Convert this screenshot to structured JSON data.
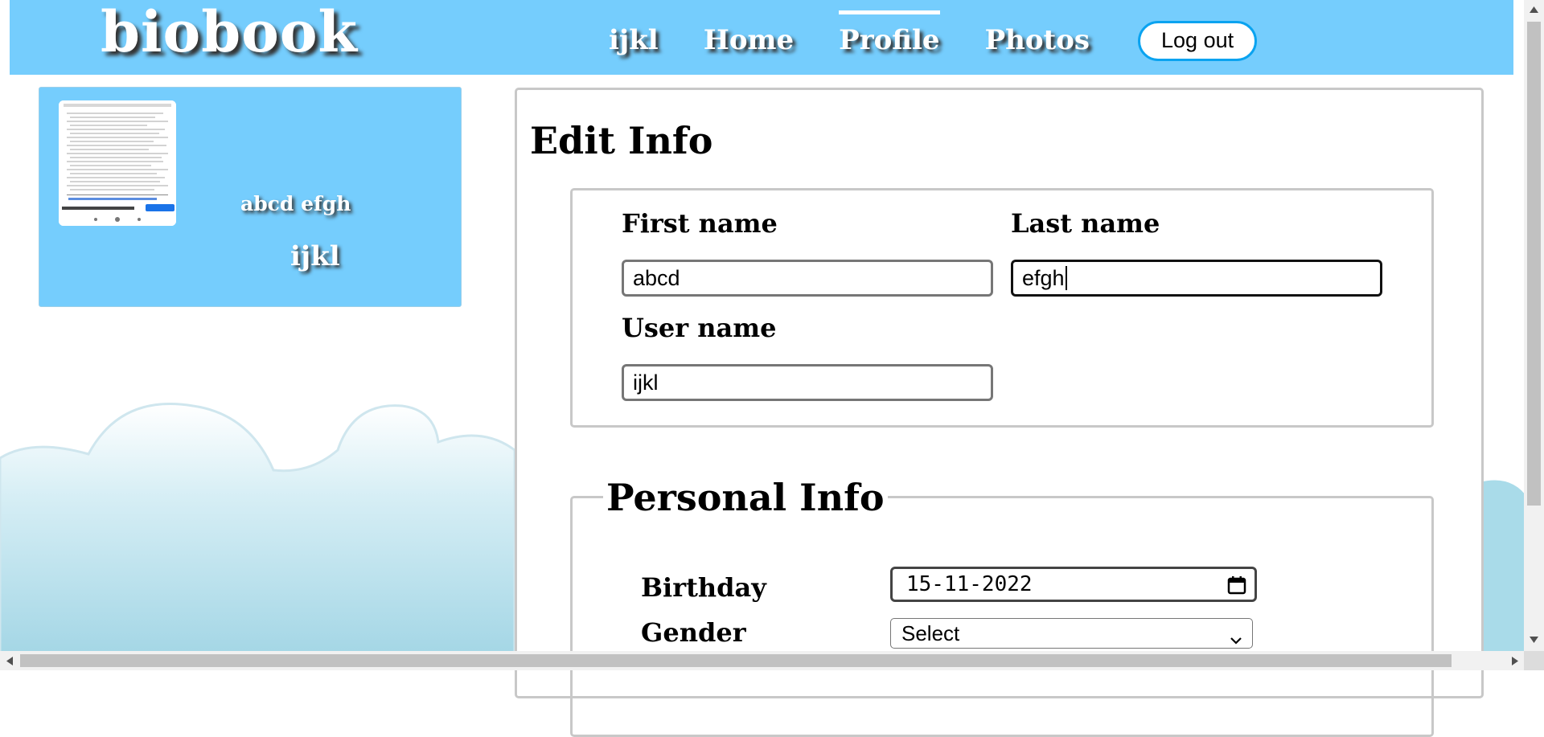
{
  "header": {
    "logo": "biobook",
    "nav": [
      {
        "label": "ijkl",
        "active": false
      },
      {
        "label": "Home",
        "active": false
      },
      {
        "label": "Profile",
        "active": true
      },
      {
        "label": "Photos",
        "active": false
      }
    ],
    "logout_label": "Log out"
  },
  "profile": {
    "full_name": "abcd efgh",
    "username": "ijkl"
  },
  "edit": {
    "title": "Edit Info",
    "first_name_label": "First name",
    "first_name_value": "abcd",
    "last_name_label": "Last name",
    "last_name_value": "efgh",
    "user_name_label": "User name",
    "user_name_value": "ijkl"
  },
  "personal": {
    "legend": "Personal Info",
    "birthday_label": "Birthday",
    "birthday_value": "15-11-2022",
    "gender_label": "Gender",
    "gender_value": "Select"
  },
  "colors": {
    "header_bg": "#75cdfd",
    "logout_border": "#0aa3f0",
    "panel_border": "#c8c8c8"
  }
}
